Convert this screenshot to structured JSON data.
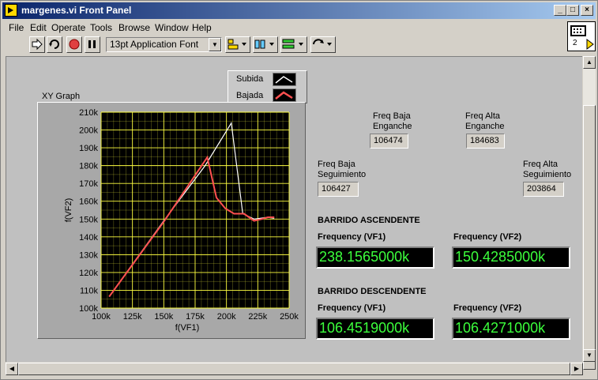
{
  "window": {
    "title": "margenes.vi Front Panel"
  },
  "menu": [
    "File",
    "Edit",
    "Operate",
    "Tools",
    "Browse",
    "Window",
    "Help"
  ],
  "toolbar": {
    "font": "13pt Application Font"
  },
  "connector": {
    "label": "2"
  },
  "graph": {
    "label": "XY Graph",
    "legend": [
      {
        "name": "Subida",
        "color": "#ffffff"
      },
      {
        "name": "Bajada",
        "color": "#ff5050"
      }
    ]
  },
  "chart_data": {
    "type": "line",
    "title": "XY Graph",
    "xlabel": "f(VF1)",
    "ylabel": "f(VF2)",
    "xlim": [
      100000,
      250000
    ],
    "ylim": [
      100000,
      210000
    ],
    "xticks": [
      "100k",
      "125k",
      "150k",
      "175k",
      "200k",
      "225k",
      "250k"
    ],
    "yticks": [
      "100k",
      "110k",
      "120k",
      "130k",
      "140k",
      "150k",
      "160k",
      "170k",
      "180k",
      "190k",
      "200k",
      "210k"
    ],
    "grid": true,
    "background": "#000000",
    "grid_color": "#ffff40",
    "series": [
      {
        "name": "Subida",
        "color": "#ffffff",
        "x": [
          106427,
          150000,
          183000,
          203864,
          213000,
          222000,
          228000,
          233000,
          238157
        ],
        "y": [
          106474,
          149000,
          180000,
          203864,
          153000,
          150000,
          150500,
          151000,
          150429
        ]
      },
      {
        "name": "Bajada",
        "color": "#ff5050",
        "x": [
          106452,
          150000,
          184683,
          192000,
          199000,
          206000,
          214000,
          222000,
          228000,
          233000,
          238157
        ],
        "y": [
          106427,
          148500,
          184683,
          162000,
          156000,
          153000,
          153000,
          149000,
          150000,
          151000,
          151000
        ]
      }
    ]
  },
  "freq": {
    "baja_enganche": {
      "label1": "Freq Baja",
      "label2": "Enganche",
      "value": "106474"
    },
    "alta_enganche": {
      "label1": "Freq Alta",
      "label2": "Enganche",
      "value": "184683"
    },
    "baja_seguimiento": {
      "label1": "Freq Baja",
      "label2": "Seguimiento",
      "value": "106427"
    },
    "alta_seguimiento": {
      "label1": "Freq Alta",
      "label2": "Seguimiento",
      "value": "203864"
    }
  },
  "ascendente": {
    "title": "BARRIDO ASCENDENTE",
    "vf1_label": "Frequency (VF1)",
    "vf1_value": "238.1565000k",
    "vf2_label": "Frequency (VF2)",
    "vf2_value": "150.4285000k"
  },
  "descendente": {
    "title": "BARRIDO DESCENDENTE",
    "vf1_label": "Frequency (VF1)",
    "vf1_value": "106.4519000k",
    "vf2_label": "Frequency (VF2)",
    "vf2_value": "106.4271000k"
  }
}
